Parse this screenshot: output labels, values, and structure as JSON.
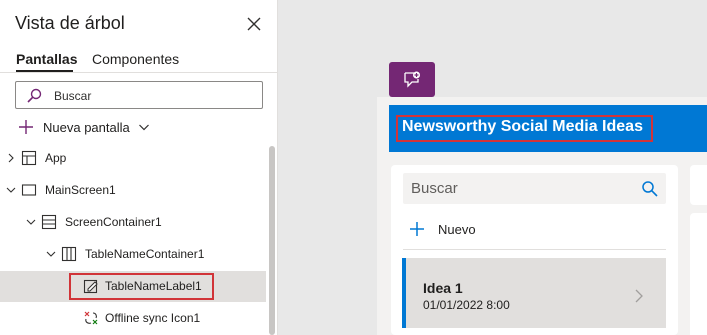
{
  "tree_view": {
    "title": "Vista de árbol",
    "tabs": [
      {
        "label": "Pantallas",
        "active": true
      },
      {
        "label": "Componentes",
        "active": false
      }
    ],
    "search_placeholder": "Buscar",
    "new_screen_label": "Nueva pantalla",
    "items": [
      {
        "label": "App",
        "icon": "app-icon",
        "expanded": false,
        "selected": false
      },
      {
        "label": "MainScreen1",
        "icon": "screen-icon",
        "expanded": true,
        "selected": false
      },
      {
        "label": "ScreenContainer1",
        "icon": "vertical-container-icon",
        "expanded": true,
        "selected": false
      },
      {
        "label": "TableNameContainer1",
        "icon": "horizontal-container-icon",
        "expanded": true,
        "selected": false
      },
      {
        "label": "TableNameLabel1",
        "icon": "label-icon",
        "expanded": null,
        "selected": true
      },
      {
        "label": "Offline sync Icon1",
        "icon": "sync-icon",
        "expanded": null,
        "selected": false
      }
    ]
  },
  "canvas": {
    "header_title": "Newsworthy Social Media Ideas",
    "list_search_placeholder": "Buscar",
    "new_item_label": "Nuevo",
    "list_items": [
      {
        "title": "Idea 1",
        "date": "01/01/2022 8:00"
      }
    ]
  },
  "colors": {
    "header_blue": "#0078d4",
    "comment_purple": "#742774",
    "highlight_red": "#d13438",
    "selected_row": "#e1dfdd"
  }
}
